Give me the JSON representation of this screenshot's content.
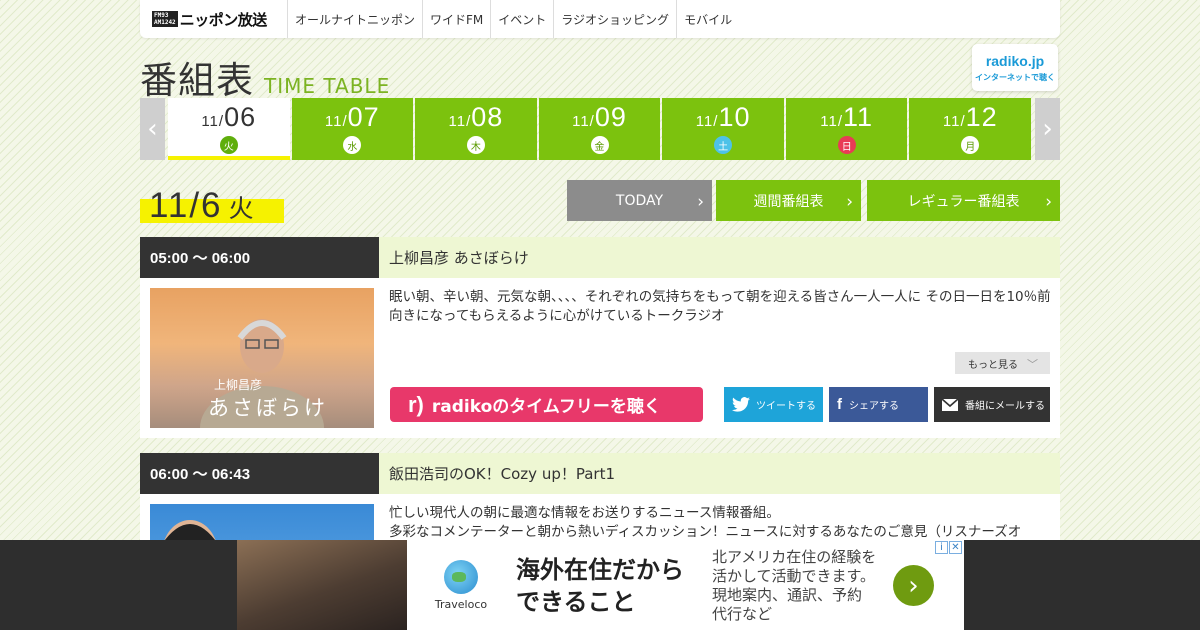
{
  "nav": {
    "logo_badge_top": "FM93",
    "logo_badge_bottom": "AM1242",
    "logo_text": "ニッポン放送",
    "items": [
      "オールナイトニッポン",
      "ワイドFM",
      "イベント",
      "ラジオショッピング",
      "モバイル"
    ]
  },
  "header": {
    "title_jp": "番組表",
    "title_en": "TIME TABLE",
    "radiko_name": "radiko.jp",
    "radiko_tag": "インターネットで聴く"
  },
  "dates": [
    {
      "month": "11/",
      "day": "06",
      "dow": "火",
      "active": true
    },
    {
      "month": "11/",
      "day": "07",
      "dow": "水"
    },
    {
      "month": "11/",
      "day": "08",
      "dow": "木"
    },
    {
      "month": "11/",
      "day": "09",
      "dow": "金"
    },
    {
      "month": "11/",
      "day": "10",
      "dow": "土"
    },
    {
      "month": "11/",
      "day": "11",
      "dow": "日"
    },
    {
      "month": "11/",
      "day": "12",
      "dow": "月"
    }
  ],
  "date_nav": {
    "prev_icon": "‹",
    "next_icon": "›"
  },
  "current": {
    "date": "11/6",
    "dow": "火"
  },
  "buttons": {
    "today": "TODAY",
    "weekly": "週間番組表",
    "regular": "レギュラー番組表",
    "chevron": "›"
  },
  "programs": [
    {
      "time": "05:00 ～ 06:00",
      "title": "上柳昌彦 あさぼらけ",
      "desc": "眠い朝、辛い朝、元気な朝、、、、それぞれの気持ちをもって朝を迎える皆さん一人一人に その日一日を10％前向きになってもらえるように心がけているトークラジオ",
      "thumb_caption_small": "上柳昌彦",
      "thumb_caption": "あさぼらけ",
      "more": "もっと見る",
      "radiko_btn": "radikoのタイムフリーを聴く",
      "tweet": "ツイートする",
      "share": "シェアする",
      "mail": "番組にメールする"
    },
    {
      "time": "06:00 ～ 06:43",
      "title": "飯田浩司のOK！Cozy up！Part1",
      "desc_line1": "忙しい現代人の朝に最適な情報をお送りするニュース情報番組。",
      "desc_line2": "多彩なコメンテーターと朝から熱いディスカッション！ニュースに対するあなたのご意見（リスナーズオ"
    }
  ],
  "ad": {
    "brand": "Traveloco",
    "headline1": "海外在住だから",
    "headline2": "できること",
    "sub1": "北アメリカ在住の経験を",
    "sub2": "活かして活動できます。",
    "sub3": "現地案内、通訳、予約",
    "sub4": "代行など",
    "go": "›",
    "info_i": "i",
    "info_x": "✕"
  },
  "colors": {
    "green": "#7cc20e",
    "yellow": "#f6f200",
    "dark": "#333333",
    "radiko_pink": "#e8386a",
    "twitter": "#1ea4d9",
    "facebook": "#3b5998"
  }
}
